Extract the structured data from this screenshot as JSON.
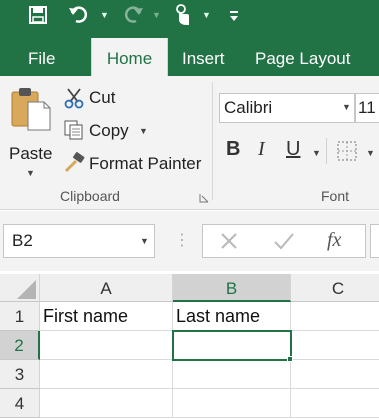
{
  "qat": {
    "save_icon": "save-icon",
    "undo_icon": "undo-icon",
    "redo_icon": "redo-icon",
    "touch_icon": "touch-mode-icon",
    "customize_icon": "customize-qat-icon"
  },
  "tabs": [
    {
      "label": "File"
    },
    {
      "label": "Home"
    },
    {
      "label": "Insert"
    },
    {
      "label": "Page Layout"
    }
  ],
  "ribbon": {
    "clipboard": {
      "paste": "Paste",
      "cut": "Cut",
      "copy": "Copy",
      "format_painter": "Format Painter",
      "group_label": "Clipboard"
    },
    "font": {
      "font_name": "Calibri",
      "font_size": "11",
      "bold": "B",
      "italic": "I",
      "underline": "U",
      "group_label": "Font"
    }
  },
  "formula_bar": {
    "name_box": "B2",
    "fx": "fx"
  },
  "sheet": {
    "columns": [
      "A",
      "B",
      "C"
    ],
    "rows": [
      "1",
      "2",
      "3",
      "4"
    ],
    "cells": {
      "A1": "First name",
      "B1": "Last name"
    },
    "selected_cell": "B2"
  },
  "colors": {
    "accent": "#217346",
    "ribbon_bg": "#f3f3f3"
  }
}
